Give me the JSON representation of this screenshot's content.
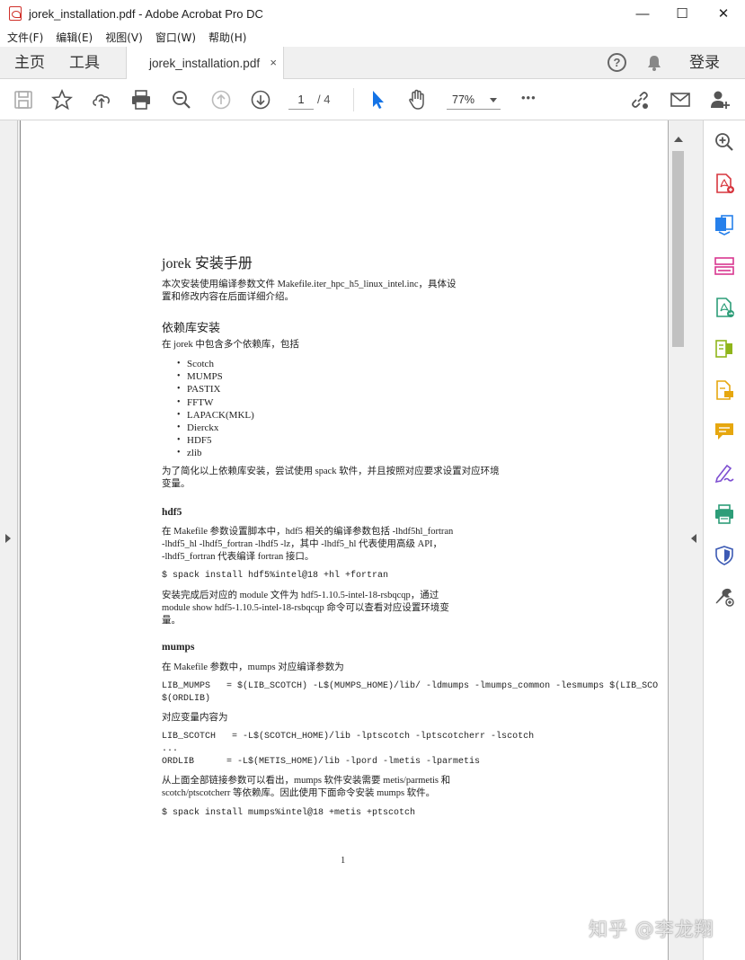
{
  "window": {
    "title": "jorek_installation.pdf - Adobe Acrobat Pro DC",
    "controls": {
      "minimize": "—",
      "maximize": "☐",
      "close": "✕"
    }
  },
  "menu": [
    "文件(F)",
    "编辑(E)",
    "视图(V)",
    "窗口(W)",
    "帮助(H)"
  ],
  "tabs": {
    "home": "主页",
    "tools": "工具",
    "document": "jorek_installation.pdf",
    "close": "×",
    "help": "?",
    "login": "登录"
  },
  "toolbar": {
    "page_current": "1",
    "page_total": "/ 4",
    "zoom": "77%",
    "more": "•••"
  },
  "colors": {
    "accent_blue": "#1473e6",
    "tool_red": "#d7373f",
    "tool_blue": "#2680eb",
    "tool_pink": "#d83790",
    "tool_green": "#2d9d78",
    "tool_lime": "#8fb51b",
    "tool_yellow": "#e6a70f",
    "tool_purple": "#7e4fd1",
    "tool_navy": "#3c5ab4"
  },
  "right_tools": [
    "zoom-in-icon",
    "create-pdf-icon",
    "combine-files-icon",
    "organize-pages-icon",
    "export-pdf-icon",
    "edit-pdf-icon",
    "comment-doc-icon",
    "comment-icon",
    "fill-sign-icon",
    "print-production-icon",
    "protect-icon",
    "more-tools-icon"
  ],
  "pdf": {
    "title": "jorek 安装手册",
    "intro_line1": "本次安装使用编译参数文件 Makefile.iter_hpc_h5_linux_intel.inc，具体设",
    "intro_line2": "置和修改内容在后面详细介绍。",
    "deps_heading": "依赖库安装",
    "deps_intro": "在 jorek 中包含多个依赖库，包括",
    "deps_list": [
      "Scotch",
      "MUMPS",
      "PASTIX",
      "FFTW",
      "LAPACK(MKL)",
      "Dierckx",
      "HDF5",
      "zlib"
    ],
    "deps_note_line1": "为了简化以上依赖库安装，尝试使用 spack 软件，并且按照对应要求设置对应环境",
    "deps_note_line2": "变量。",
    "hdf5_heading": "hdf5",
    "hdf5_line1": "在 Makefile 参数设置脚本中，hdf5 相关的编译参数包括 -lhdf5hl_fortran",
    "hdf5_line2": "-lhdf5_hl -lhdf5_fortran -lhdf5 -lz，其中 -lhdf5_hl 代表使用高级 API，",
    "hdf5_line3": "-lhdf5_fortran 代表编译 fortran 接口。",
    "hdf5_cmd": "$ spack install hdf5%intel@18 +hl +fortran",
    "hdf5_after1": "安装完成后对应的 module 文件为 hdf5-1.10.5-intel-18-rsbqcqp，通过",
    "hdf5_after2": "module show hdf5-1.10.5-intel-18-rsbqcqp 命令可以查看对应设置环境变",
    "hdf5_after3": "量。",
    "mumps_heading": "mumps",
    "mumps_intro": "在 Makefile 参数中，mumps 对应编译参数为",
    "mumps_code1": "LIB_MUMPS   = $(LIB_SCOTCH) -L$(MUMPS_HOME)/lib/ -ldmumps -lmumps_common -lesmumps $(LIB_SCO",
    "mumps_code2": "$(ORDLIB)",
    "mumps_vars": "对应变量内容为",
    "scotch_code1": "LIB_SCOTCH   = -L$(SCOTCH_HOME)/lib -lptscotch -lptscotcherr -lscotch",
    "scotch_code2": "...",
    "scotch_code3": "ORDLIB      = -L$(METIS_HOME)/lib -lpord -lmetis -lparmetis",
    "mumps_after1": "从上面全部链接参数可以看出，mumps 软件安装需要 metis/parmetis 和",
    "mumps_after2": "scotch/ptscotcherr 等依赖库。因此使用下面命令安装 mumps 软件。",
    "mumps_cmd": "$ spack install mumps%intel@18 +metis +ptscotch",
    "page_number": "1"
  },
  "watermark": "知乎 @李龙翔"
}
